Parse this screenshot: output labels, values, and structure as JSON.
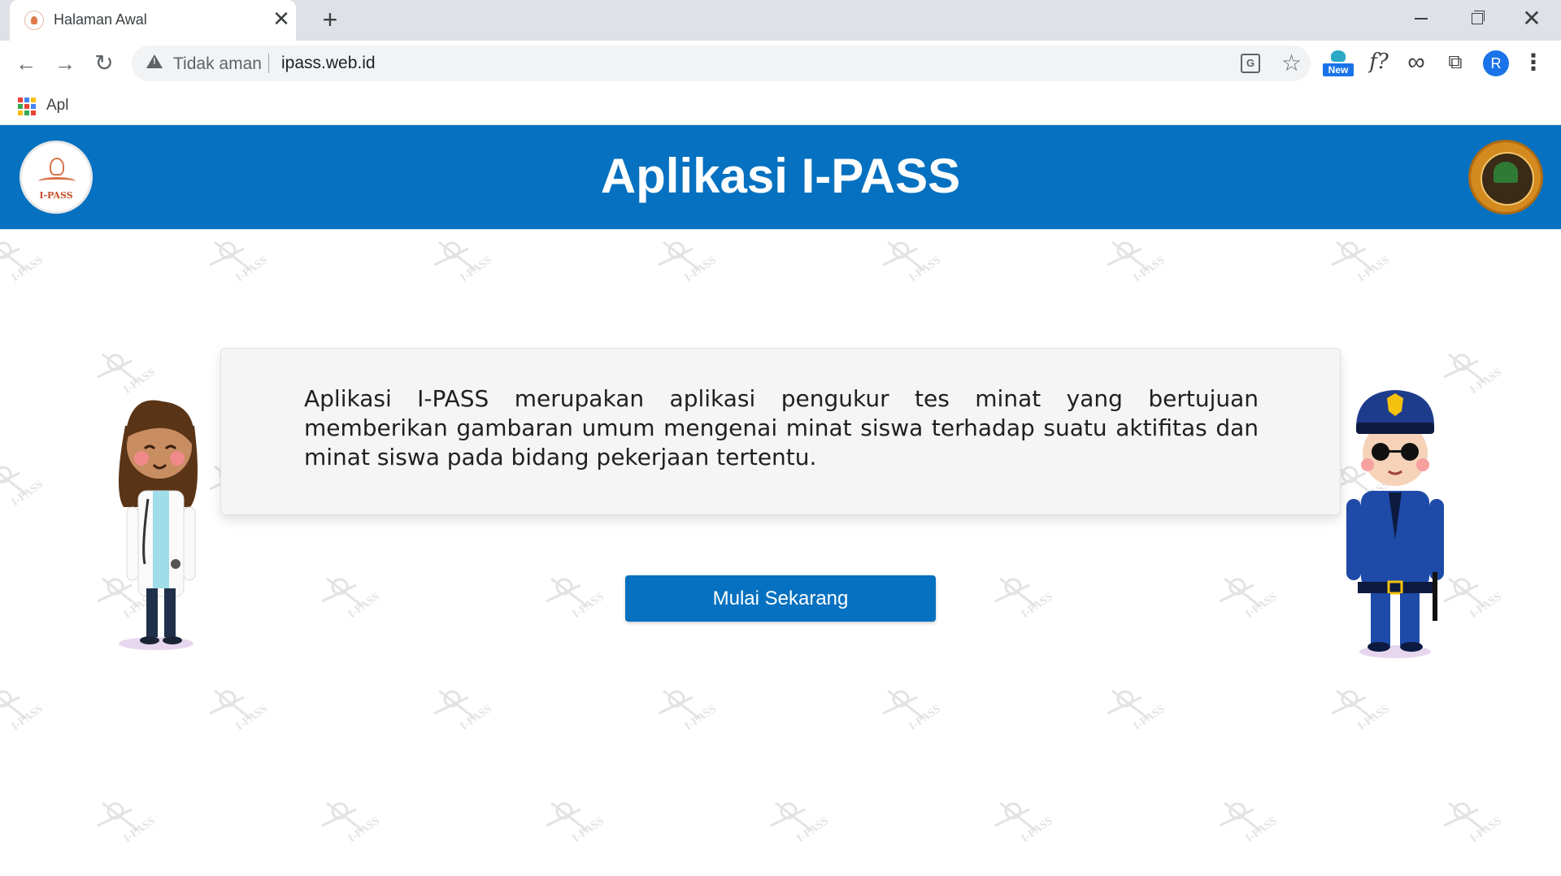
{
  "browser": {
    "tab_title": "Halaman Awal",
    "tab_close": "✕",
    "new_tab": "+",
    "window_close": "✕",
    "nav": {
      "back": "←",
      "forward": "→",
      "reload": "↻"
    },
    "omnibox": {
      "security_label": "Tidak aman",
      "url": "ipass.web.id"
    },
    "translate_glyph": "G",
    "star_glyph": "☆",
    "extensions": {
      "new_badge": "New",
      "f_ext": "f?",
      "infinity": "∞",
      "puzzle": "⧉"
    },
    "profile_initial": "R",
    "menu": "⋮",
    "bookmarks": {
      "apps_label": "Apl"
    }
  },
  "page": {
    "title": "Aplikasi I-PASS",
    "logo_text": "I-PASS",
    "description": "Aplikasi I-PASS merupakan aplikasi pengukur tes minat yang bertujuan memberikan gambaran umum mengenai minat siswa terhadap suatu aktifitas dan minat siswa pada bidang pekerjaan tertentu.",
    "cta_label": "Mulai Sekarang",
    "watermark_text": "I-PASS"
  },
  "colors": {
    "brand_blue": "#0571c0",
    "accent_orange": "#d9734b",
    "card_bg": "#f5f5f5"
  }
}
